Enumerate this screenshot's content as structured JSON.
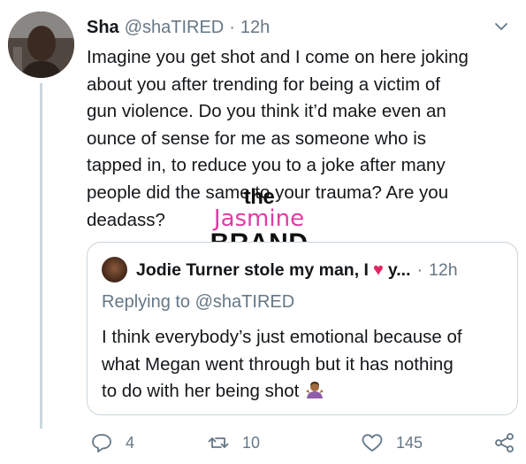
{
  "tweet": {
    "author_name": "Sha",
    "author_handle": "@shaTIRED",
    "separator": "·",
    "time": "12h",
    "text": "Imagine you get shot and I come on here joking\nabout you after trending for being a victim of\ngun violence. Do you think it’d make even an\nounce of sense for me as someone who is\ntapped in, to reduce you to a joke after many\npeople did the same to your trauma? Are you\ndeadass?"
  },
  "watermark": {
    "line1": "the",
    "line2": "Jasmine",
    "line3": "BRAND"
  },
  "quoted_tweet": {
    "author_name_part1": "Jodie Turner stole my man, I",
    "author_name_part2": "y...",
    "separator": "·",
    "time": "12h",
    "replying_to_label": "Replying to",
    "replying_to_handle": "@shaTIRED",
    "text": "I think everybody’s just emotional because of\nwhat Megan went through but it has nothing\nto do with her being shot"
  },
  "actions": {
    "reply_count": "4",
    "retweet_count": "10",
    "like_count": "145"
  },
  "colors": {
    "secondary_text": "#657786",
    "border": "#ccd6dd",
    "heart": "#e0245e",
    "watermark_pink": "#e03ca4"
  },
  "icons": [
    "chevron-down-icon",
    "red-heart-emoji",
    "person-shrugging-emoji",
    "reply-icon",
    "retweet-icon",
    "like-icon",
    "share-icon"
  ]
}
